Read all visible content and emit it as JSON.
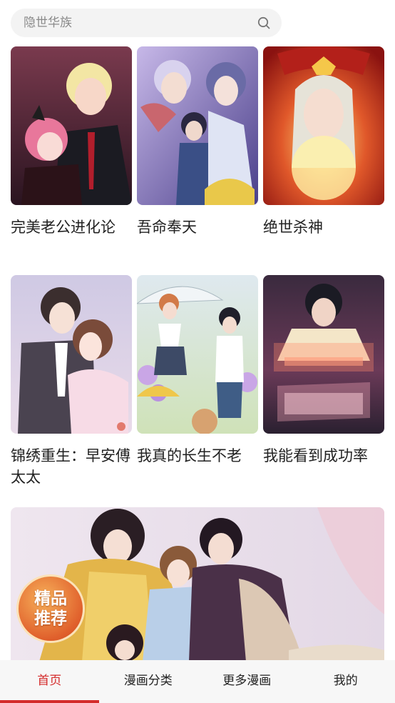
{
  "search": {
    "placeholder": "隐世华族",
    "icon": "search-icon"
  },
  "comics": [
    {
      "title": "完美老公进化论"
    },
    {
      "title": "吾命奉天"
    },
    {
      "title": "绝世杀神"
    },
    {
      "title": "锦绣重生：早安傅太太"
    },
    {
      "title": "我真的长生不老"
    },
    {
      "title": "我能看到成功率"
    }
  ],
  "banner": {
    "badge_line1": "精品",
    "badge_line2": "推荐"
  },
  "tabs": [
    {
      "label": "首页",
      "active": true
    },
    {
      "label": "漫画分类",
      "active": false
    },
    {
      "label": "更多漫画",
      "active": false
    },
    {
      "label": "我的",
      "active": false
    }
  ],
  "colors": {
    "accent": "#d42b2b",
    "search_bg": "#f3f3f3",
    "tabbar_bg": "#f7f7f7"
  }
}
